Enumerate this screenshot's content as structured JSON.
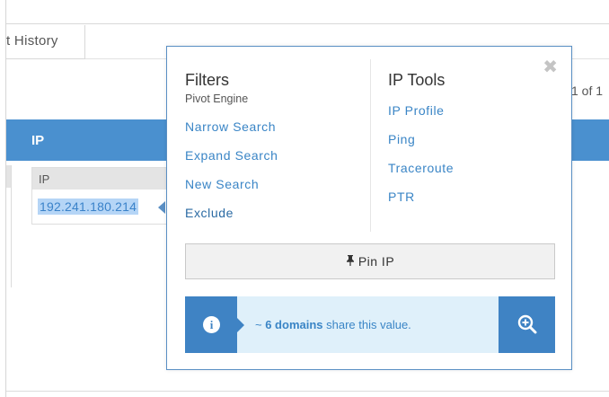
{
  "background": {
    "tab_label": "t History",
    "pager_text": "1 of 1",
    "column_header": "IP",
    "cell_header": "IP",
    "cell_value": "192.241.180.214"
  },
  "popover": {
    "filters": {
      "title": "Filters",
      "subtitle": "Pivot Engine",
      "links": [
        "Narrow Search",
        "Expand Search",
        "New Search",
        "Exclude"
      ]
    },
    "ip_tools": {
      "title": "IP Tools",
      "links": [
        "IP Profile",
        "Ping",
        "Traceroute",
        "PTR"
      ]
    },
    "close_glyph": "✖",
    "pin_button": {
      "icon": "pin-icon",
      "label": "Pin IP"
    },
    "info": {
      "icon": "info-icon",
      "prefix": "~ ",
      "count_text": "6 domains",
      "suffix": " share this value.",
      "zoom_icon": "zoom-in-icon"
    }
  },
  "colors": {
    "accent": "#4a90cf",
    "link": "#3a85c6",
    "info_bg": "#dff0fa",
    "selection": "#b5d5f6"
  }
}
